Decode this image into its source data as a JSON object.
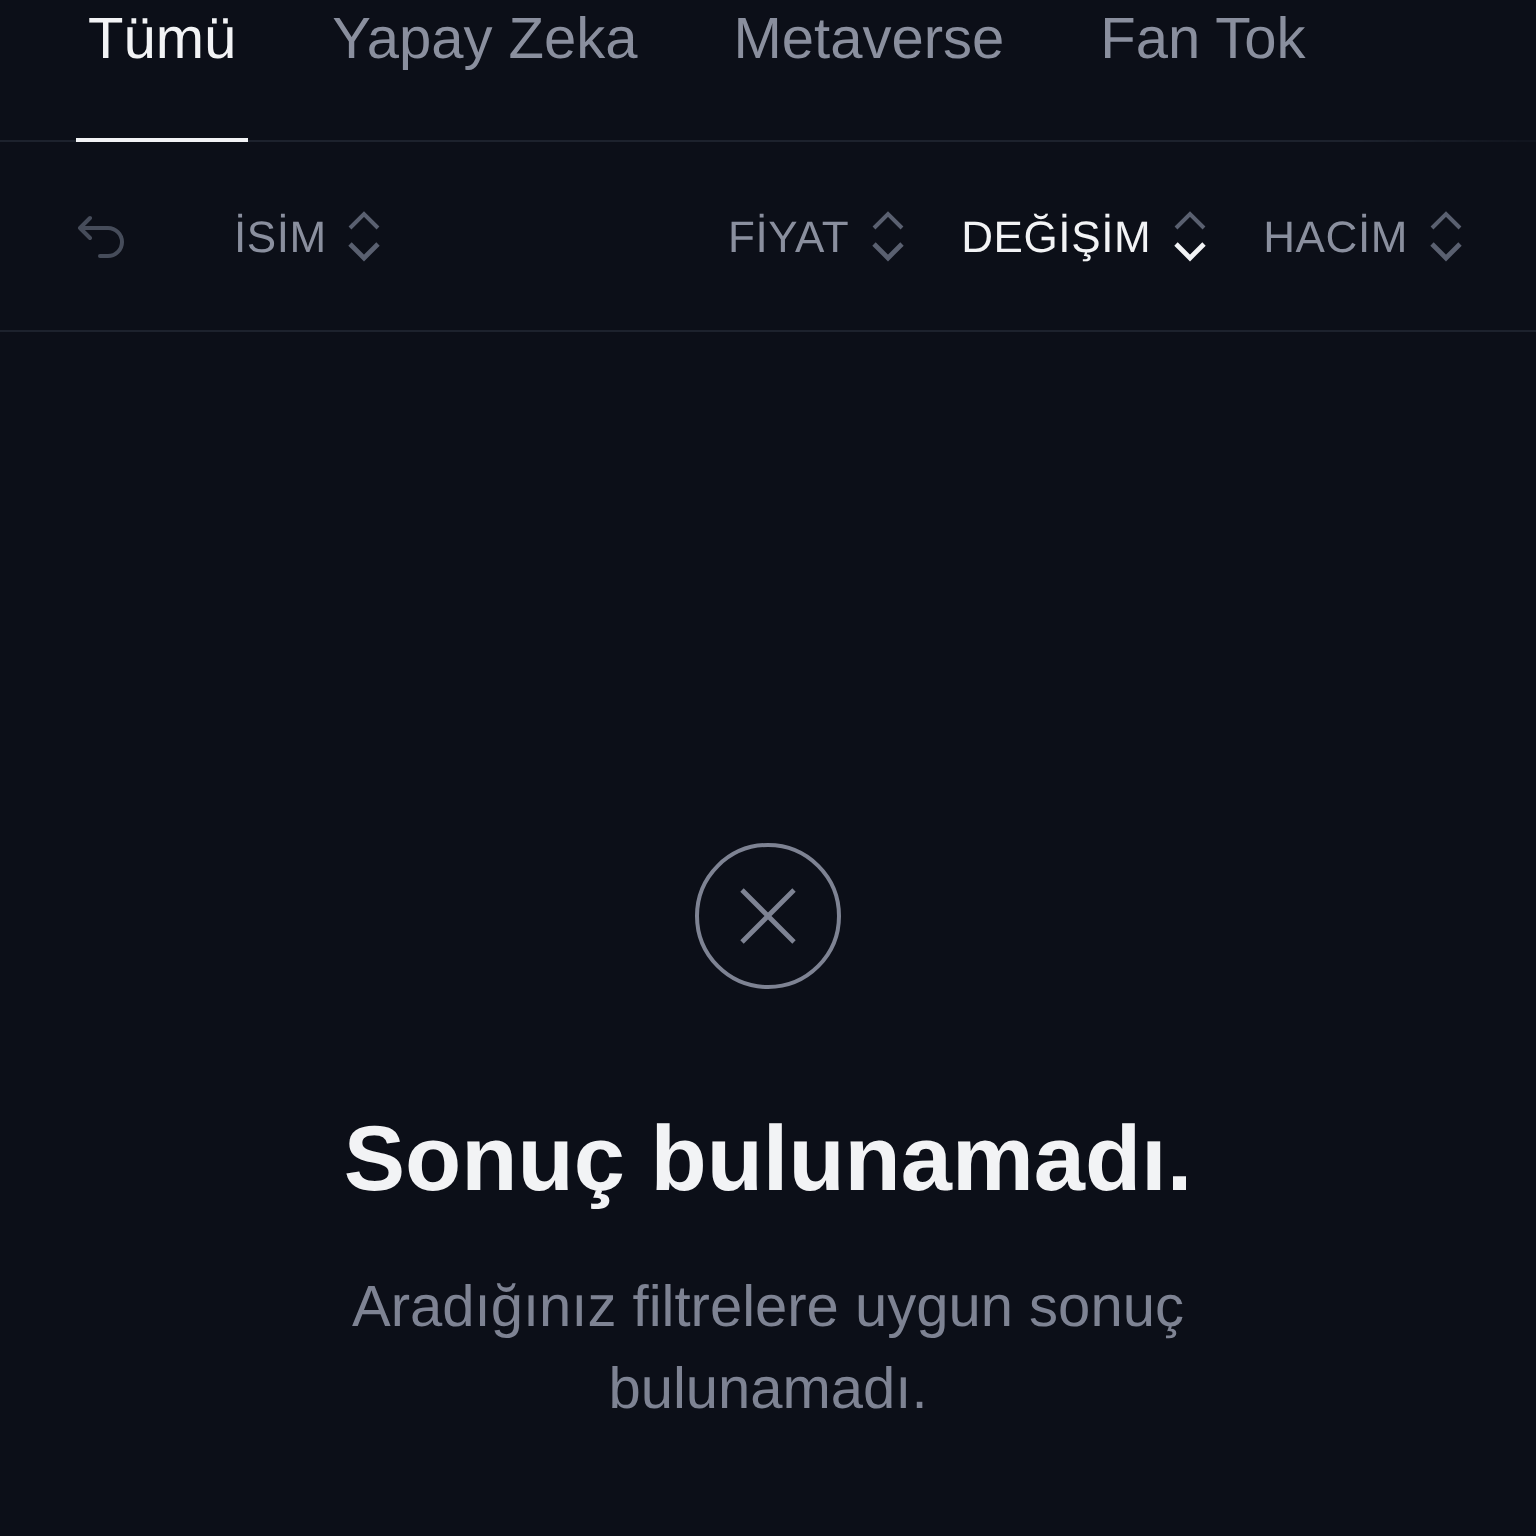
{
  "tabs": [
    {
      "label": "Tümü",
      "selected": true
    },
    {
      "label": "Yapay Zeka",
      "selected": false
    },
    {
      "label": "Metaverse",
      "selected": false
    },
    {
      "label": "Fan Tok",
      "selected": false
    }
  ],
  "columns": [
    {
      "label": "İSİM",
      "sorted_descending": false
    },
    {
      "label": "FİYAT",
      "sorted_descending": false
    },
    {
      "label": "DEĞİŞİM",
      "sorted_descending": true
    },
    {
      "label": "HACİM",
      "sorted_descending": false
    }
  ],
  "empty_state": {
    "title": "Sonuç bulunamadı.",
    "message": "Aradığınız filtrelere uygun sonuç bulunamadı."
  }
}
